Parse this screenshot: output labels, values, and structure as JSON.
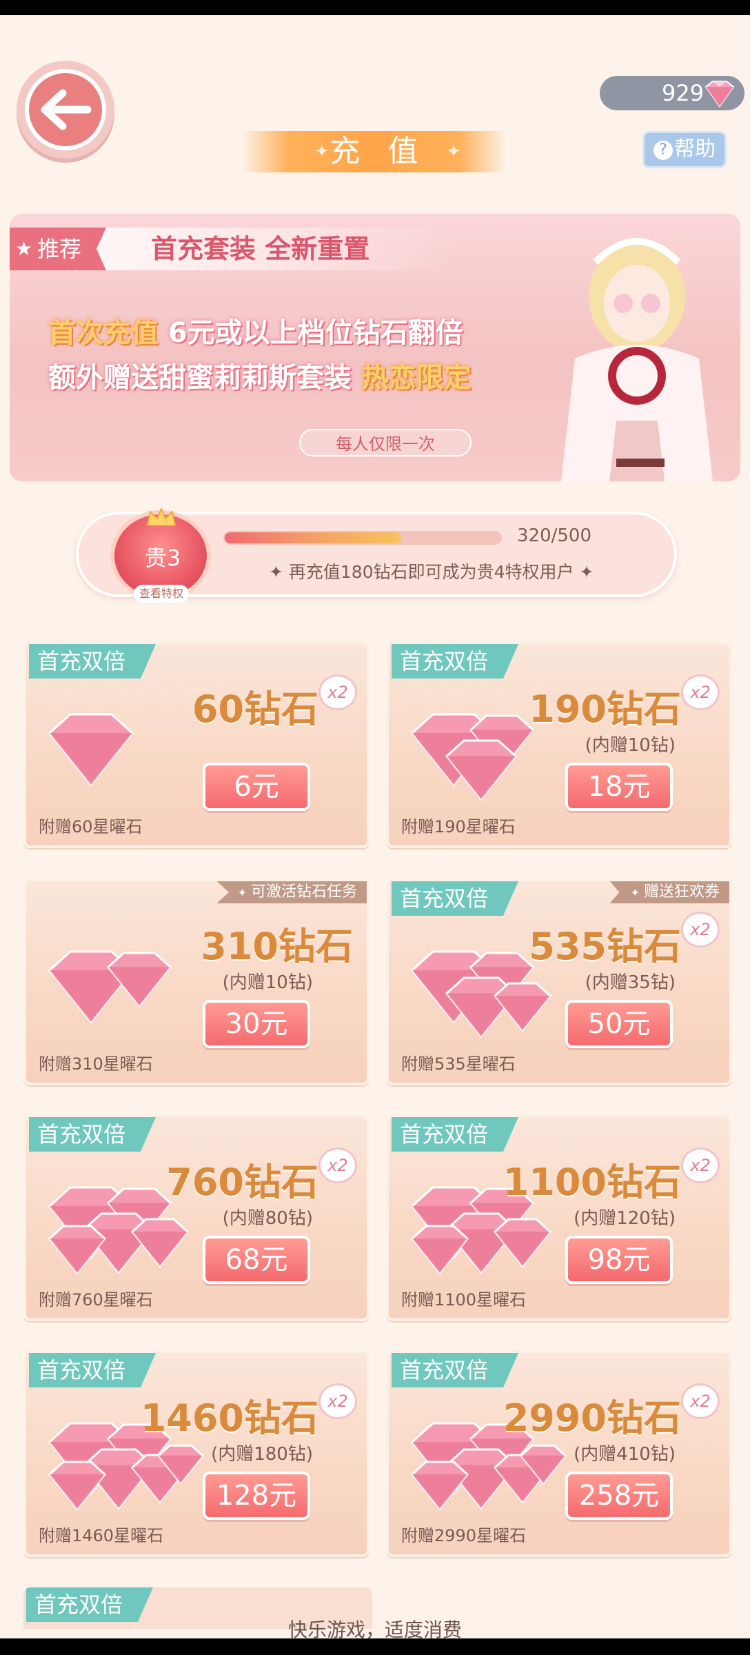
{
  "header": {
    "balance": "929",
    "title": "充值",
    "help_label": "帮助",
    "help_icon": "?"
  },
  "banner": {
    "tag_label": "推荐",
    "headline": "首充套装 全新重置",
    "line1_highlight": "首次充值",
    "line1_rest": " 6元或以上档位钻石翻倍",
    "line2_start": "额外赠送甜蜜莉莉斯套装 ",
    "line2_highlight": "热恋限定",
    "pill": "每人仅限一次"
  },
  "vip": {
    "level": "贵3",
    "link": "查看特权",
    "progress_text": "320/500",
    "progress_fraction": 0.64,
    "hint": "再充值180钻石即可成为贵4特权用户"
  },
  "colors": {
    "tag_teal": "#6fc7bd",
    "price_red": "#f56a6e",
    "amount_gold": "#d98a3b"
  },
  "products": [
    {
      "tag": "首充双倍",
      "ribbon": "",
      "amount": "60钻石",
      "x2": "x2",
      "bonus": "",
      "price": "6元",
      "gift": "附赠60星曜石"
    },
    {
      "tag": "首充双倍",
      "ribbon": "",
      "amount": "190钻石",
      "x2": "x2",
      "bonus": "(内赠10钻)",
      "price": "18元",
      "gift": "附赠190星曜石"
    },
    {
      "tag": "",
      "ribbon": "可激活钻石任务",
      "amount": "310钻石",
      "x2": "",
      "bonus": "(内赠10钻)",
      "price": "30元",
      "gift": "附赠310星曜石"
    },
    {
      "tag": "首充双倍",
      "ribbon": "赠送狂欢券",
      "amount": "535钻石",
      "x2": "x2",
      "bonus": "(内赠35钻)",
      "price": "50元",
      "gift": "附赠535星曜石"
    },
    {
      "tag": "首充双倍",
      "ribbon": "",
      "amount": "760钻石",
      "x2": "x2",
      "bonus": "(内赠80钻)",
      "price": "68元",
      "gift": "附赠760星曜石"
    },
    {
      "tag": "首充双倍",
      "ribbon": "",
      "amount": "1100钻石",
      "x2": "x2",
      "bonus": "(内赠120钻)",
      "price": "98元",
      "gift": "附赠1100星曜石"
    },
    {
      "tag": "首充双倍",
      "ribbon": "",
      "amount": "1460钻石",
      "x2": "x2",
      "bonus": "(内赠180钻)",
      "price": "128元",
      "gift": "附赠1460星曜石"
    },
    {
      "tag": "首充双倍",
      "ribbon": "",
      "amount": "2990钻石",
      "x2": "x2",
      "bonus": "(内赠410钻)",
      "price": "258元",
      "gift": "附赠2990星曜石"
    }
  ],
  "partial_tag": "首充双倍",
  "footer": "快乐游戏，适度消费"
}
